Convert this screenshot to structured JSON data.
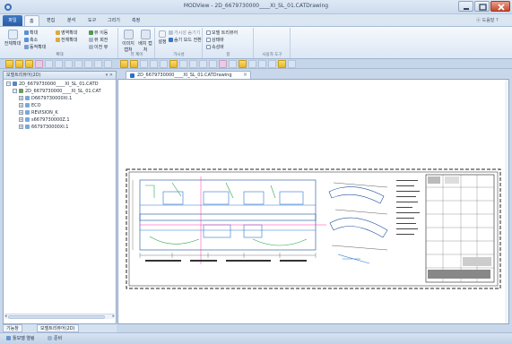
{
  "window": {
    "title": "MODView - 2D_6679730000____XI_SL_01.CATDrawing"
  },
  "ribbon": {
    "tabs": [
      {
        "label": "파일"
      },
      {
        "label": "홈"
      },
      {
        "label": "편집"
      },
      {
        "label": "분석"
      },
      {
        "label": "도구"
      },
      {
        "label": "그리기"
      },
      {
        "label": "측정"
      }
    ],
    "help_label": "ⓐ 도움말 ?",
    "groups": {
      "zoom": {
        "title": "확대",
        "fit_label": "전체확대",
        "zoom_in": "확대",
        "zoom_out": "축소",
        "dynamic_zoom": "동적확대",
        "zoom_window": "영역확대",
        "fit_window": "전체확대"
      },
      "view": {
        "title": "뷰 제어",
        "prev": "뷰 이동",
        "next": "뷰 회전",
        "pan": "이전 뷰",
        "image_capture": "이미지 캡처",
        "batch_capture": "배치 캡처"
      },
      "visual": {
        "title": "가시성",
        "show_all": "가시성 숨기기",
        "hide": "숨기 모드 전환",
        "color": "설정"
      },
      "display": {
        "title": "창",
        "model_tree": "모델 트리뷰어",
        "property": "상태바",
        "annotation": "속성바"
      },
      "user": {
        "title": "사용자 도구"
      }
    }
  },
  "document_tab": {
    "label": "2D_6679730000____XI_SL_01.CATDrawing"
  },
  "left_panel": {
    "title": "모델트리뷰어(2D)",
    "pane_buttons": "▾ ✕",
    "tree": [
      {
        "label": "2D_6679730000____XI_SL_01.CATD"
      },
      {
        "label": "2D_6679730000____XI_SL_01.CAT"
      },
      {
        "label": "D6679730000XI.1"
      },
      {
        "label": "ECO"
      },
      {
        "label": "REVISION_K"
      },
      {
        "label": "s6679730000Z.1"
      },
      {
        "label": "6679730000XI.1"
      }
    ]
  },
  "bottom_tabs": {
    "tab1": "기능창",
    "tab2": "모델트리뷰어(2D)"
  },
  "statusbar": {
    "item1": "툴모델 열림",
    "item2": "준비"
  }
}
